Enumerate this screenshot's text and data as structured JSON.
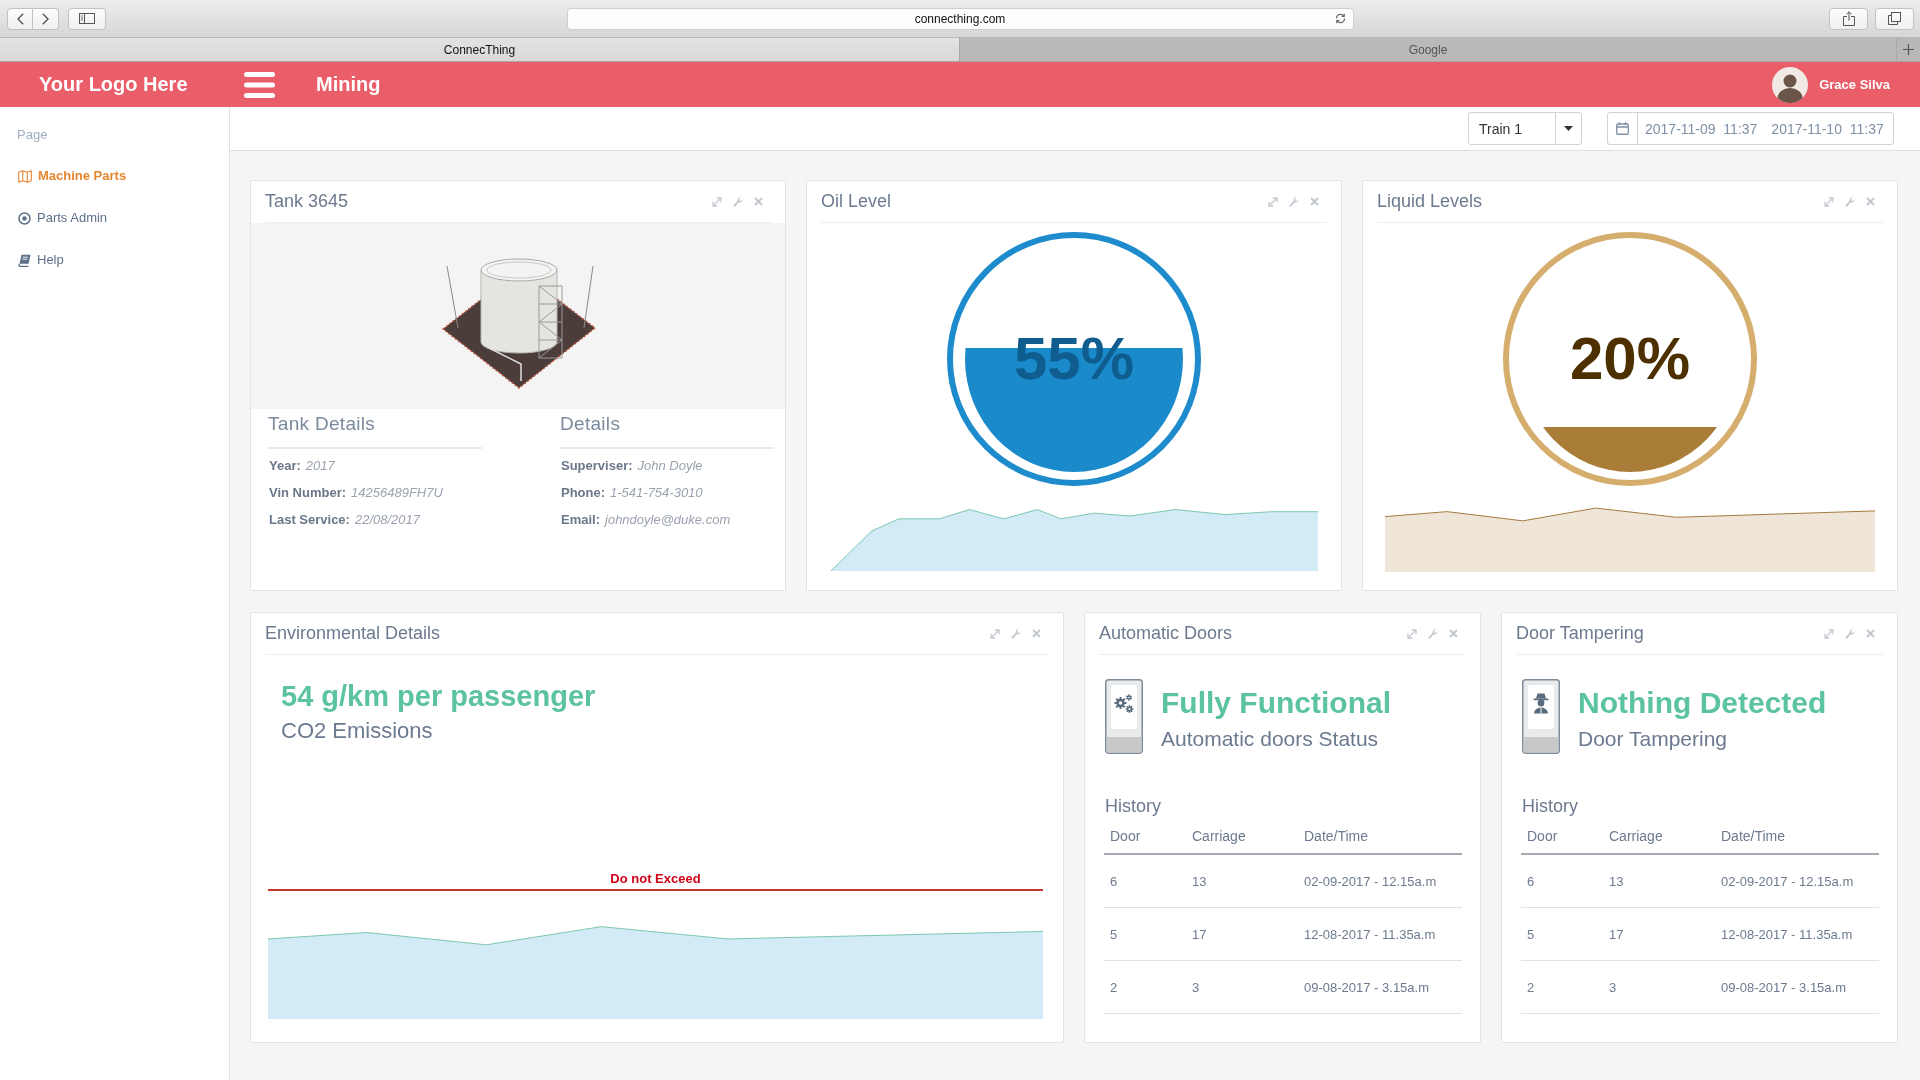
{
  "browser": {
    "url": "connecthing.com",
    "tabs": [
      {
        "label": "ConnecThing",
        "selected": true
      },
      {
        "label": "Google",
        "selected": false
      }
    ]
  },
  "header": {
    "logo": "Your Logo Here",
    "title": "Mining",
    "user": "Grace Silva"
  },
  "sidebar": {
    "heading": "Page",
    "items": [
      {
        "label": "Machine Parts",
        "selected": true
      },
      {
        "label": "Parts Admin",
        "selected": false
      },
      {
        "label": "Help",
        "selected": false
      }
    ]
  },
  "filters": {
    "train": "Train 1",
    "date_from": "2017-11-09  11:37",
    "date_to": "2017-11-10  11:37"
  },
  "tank": {
    "title": "Tank 3645",
    "sections": [
      {
        "heading": "Tank Details",
        "rows": [
          {
            "label": "Year:",
            "value": "2017"
          },
          {
            "label": "Vin Number:",
            "value": "14256489FH7U"
          },
          {
            "label": "Last Service:",
            "value": "22/08/2017"
          }
        ]
      },
      {
        "heading": "Details",
        "rows": [
          {
            "label": "Superviser:",
            "value": "John Doyle"
          },
          {
            "label": "Phone:",
            "value": "1-541-754-3010"
          },
          {
            "label": "Email:",
            "value": "johndoyle@duke.com"
          }
        ]
      }
    ]
  },
  "gauges": [
    {
      "kind": "oil",
      "title": "Oil Level",
      "reading": "55%",
      "level": 0.55
    },
    {
      "kind": "liquid",
      "title": "Liquid Levels",
      "reading": "20%",
      "level": 0.2
    }
  ],
  "environment": {
    "title": "Environmental Details",
    "value": "54 g/km per passenger",
    "label": "CO2 Emissions",
    "limit_label": "Do not Exceed"
  },
  "status_cards": [
    {
      "title": "Automatic Doors",
      "status": "Fully Functional",
      "caption": "Automatic doors Status",
      "history_title": "History",
      "columns": [
        "Door",
        "Carriage",
        "Date/Time"
      ],
      "rows": [
        [
          "6",
          "13",
          "02-09-2017 - 12.15a.m"
        ],
        [
          "5",
          "17",
          "12-08-2017 - 11.35a.m"
        ],
        [
          "2",
          "3",
          "09-08-2017 - 3.15a.m"
        ]
      ]
    },
    {
      "title": "Door Tampering",
      "status": "Nothing Detected",
      "caption": "Door Tampering",
      "history_title": "History",
      "columns": [
        "Door",
        "Carriage",
        "Date/Time"
      ],
      "rows": [
        [
          "6",
          "13",
          "02-09-2017 - 12.15a.m"
        ],
        [
          "5",
          "17",
          "12-08-2017 - 11.35a.m"
        ],
        [
          "2",
          "3",
          "09-08-2017 - 3.15a.m"
        ]
      ]
    }
  ]
}
